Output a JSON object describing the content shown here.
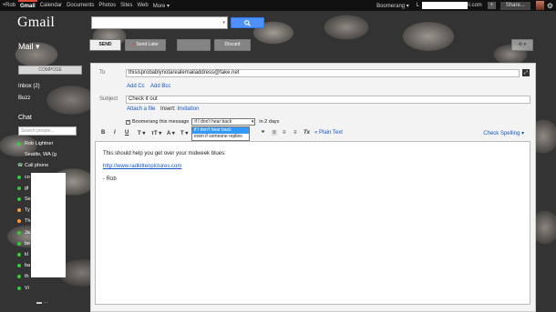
{
  "topbar": {
    "nav": [
      "+Rob",
      "Gmail",
      "Calendar",
      "Documents",
      "Photos",
      "Sites",
      "Web",
      "More ▾"
    ],
    "boomerang": "Boomerang ▾",
    "email_prefix": "L",
    "email_suffix": "il.com",
    "share": "Share...",
    "square_btn": "+"
  },
  "logo": "Gmail",
  "search": {
    "value": "",
    "caret": "▾",
    "button_icon": "🔍"
  },
  "mail_label": "Mail ▾",
  "toolbar": {
    "send": "SEND",
    "send_later": "Send Later",
    "discard": "Discard",
    "gear": "⚙ ▾"
  },
  "sidebar": {
    "compose": "COMPOSE",
    "inbox": "Inbox (2)",
    "buzz": "Buzz",
    "chat_title": "Chat",
    "chat_search_placeholder": "Search people...",
    "contacts": [
      {
        "name": "Rob Lightner",
        "status": "green"
      },
      {
        "name": "Seattle, WA (g",
        "status": "none"
      },
      {
        "name": "Call phone",
        "status": "phone"
      },
      {
        "name": "co",
        "status": "green"
      },
      {
        "name": "gl",
        "status": "green"
      },
      {
        "name": "Se",
        "status": "green"
      },
      {
        "name": "Ty",
        "status": "orange"
      },
      {
        "name": "Th",
        "status": "orange"
      },
      {
        "name": "Ja",
        "status": "green"
      },
      {
        "name": "be",
        "status": "green"
      },
      {
        "name": "kl",
        "status": "green"
      },
      {
        "name": "ba",
        "status": "green"
      },
      {
        "name": "th",
        "status": "green"
      },
      {
        "name": "Vi",
        "status": "green"
      }
    ],
    "chat_bottom": "▬  ···"
  },
  "compose": {
    "to_label": "To",
    "to_value": "thisisprobablynotarealemailaddress@fake.net",
    "add_cc": "Add Cc",
    "add_bcc": "Add Bcc",
    "subject_label": "Subject",
    "subject_value": "Check it out",
    "attach": "Attach a file",
    "insert_label": "Insert:",
    "invitation": "Invitation",
    "boomerang_label": "Boomerang this message",
    "boomerang_select": "if I don't hear back",
    "boomerang_days": "in 2 days",
    "dropdown_options": [
      "if I don't hear back",
      "even if someone replies"
    ],
    "format": {
      "bold": "B",
      "italic": "I",
      "underline": "U",
      "font": "T ▾",
      "size": "тT ▾",
      "color": "A ▾",
      "bgcolor": "T ▾",
      "quote": "❞",
      "align_left": "≡",
      "align_center": "≡",
      "align_right": "≡",
      "clear": "Tx",
      "plain_text": "« Plain Text",
      "check_spelling": "Check Spelling ▾"
    },
    "body_line1": "This should help you get over your midweek blues:",
    "body_link": "http://www.radkittenpictures.com",
    "body_sign": "- Rob"
  }
}
